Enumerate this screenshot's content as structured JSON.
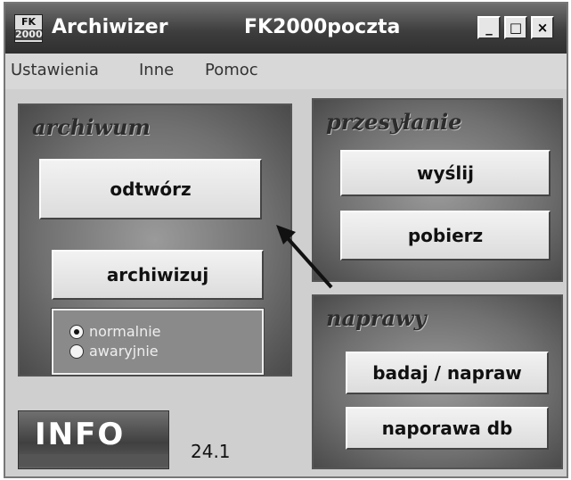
{
  "window": {
    "app_title": "Archiwizer",
    "db_title": "FK2000poczta",
    "icon_top": "FK",
    "icon_bottom": "2000",
    "controls": {
      "minimize": "_",
      "maximize": "□",
      "close": "×"
    }
  },
  "menu": [
    "Ustawienia",
    "Inne",
    "Pomoc"
  ],
  "archiwum": {
    "title": "archiwum",
    "restore_label": "odtwórz",
    "archive_label": "archiwizuj",
    "modes": [
      {
        "label": "normalnie",
        "selected": true
      },
      {
        "label": "awaryjnie",
        "selected": false
      }
    ]
  },
  "przesylanie": {
    "title": "przesyłanie",
    "send_label": "wyślij",
    "fetch_label": "pobierz"
  },
  "naprawy": {
    "title": "naprawy",
    "check_label": "badaj / napraw",
    "db_repair_label": "naporawa db"
  },
  "info": {
    "label": "INFO",
    "version": "24.1"
  }
}
